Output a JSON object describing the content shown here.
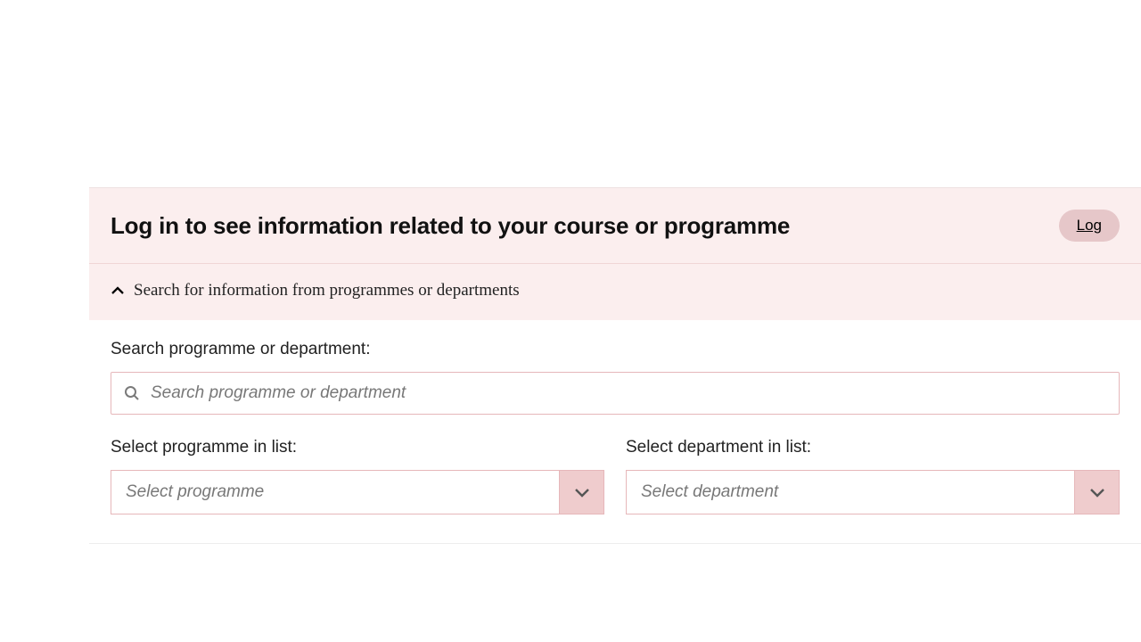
{
  "login": {
    "heading": "Log in to see information related to your course or programme",
    "button": "Log"
  },
  "toggle": {
    "label": "Search for information from programmes or departments"
  },
  "search": {
    "label": "Search programme or department:",
    "placeholder": "Search programme or department"
  },
  "programme": {
    "label": "Select programme in list:",
    "placeholder": "Select programme"
  },
  "department": {
    "label": "Select department in list:",
    "placeholder": "Select department"
  }
}
